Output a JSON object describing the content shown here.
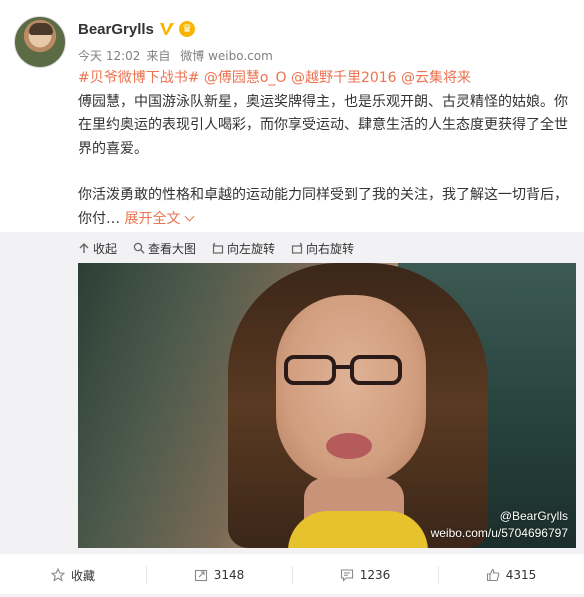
{
  "post": {
    "username": "BearGrylls",
    "time": "今天 12:02",
    "source_prefix": "来自",
    "source": "微博 weibo.com",
    "tags": "#贝爷微博下战书# @傅园慧o_O @越野千里2016 @云集将来",
    "paragraph1": "傅园慧，中国游泳队新星，奥运奖牌得主，也是乐观开朗、古灵精怪的姑娘。你在里约奥运的表现引人喝彩，而你享受运动、肆意生活的人生态度更获得了全世界的喜爱。",
    "paragraph2": "你活泼勇敢的性格和卓越的运动能力同样受到了我的关注，我了解这一切背后，你付…",
    "expand_label": "展开全文"
  },
  "media_toolbar": {
    "collapse": "收起",
    "view_large": "查看大图",
    "rotate_left": "向左旋转",
    "rotate_right": "向右旋转"
  },
  "watermark": {
    "line1": "@BearGrylls",
    "line2": "weibo.com/u/5704696797"
  },
  "actions": {
    "favorite": "收藏",
    "reposts": "3148",
    "comments": "1236",
    "likes": "4315"
  },
  "colors": {
    "accent": "#eb7350",
    "verified": "#f7b500",
    "text": "#333333",
    "meta": "#808080"
  }
}
